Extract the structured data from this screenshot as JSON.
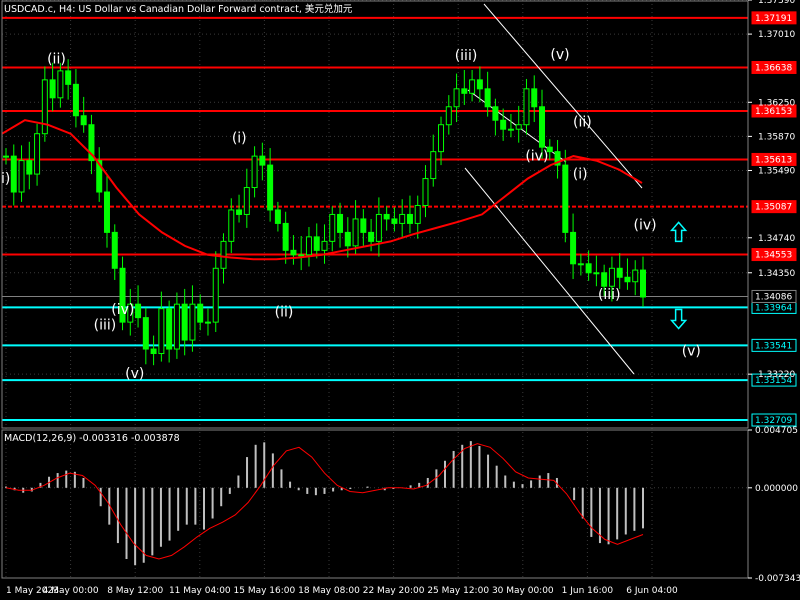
{
  "header": {
    "title": "USDCAD.c, H4:  US Dollar vs Canadian Dollar Forward contract, 美元兑加元",
    "macd_label": "MACD(12,26,9) -0.003316 -0.003878"
  },
  "colors": {
    "background": "#000000",
    "grid": "#3a3a3a",
    "candle": "#00ff00",
    "red_level": "#ff0000",
    "cyan_level": "#00ffff",
    "ma": "#ff0000",
    "channel": "#ffffff",
    "macd_hist": "#c0c0c0",
    "macd_signal": "#ff0000"
  },
  "chart_data": {
    "type": "candlestick",
    "symbol": "USDCAD.c",
    "timeframe": "H4",
    "price_axis": {
      "range": [
        1.3262,
        1.3739
      ],
      "ticks": [
        "1.37390",
        "1.37010",
        "1.36250",
        "1.35870",
        "1.35490",
        "1.34740",
        "1.34350",
        "1.33220"
      ]
    },
    "time_axis": {
      "labels": [
        "1 May 2023",
        "4 May 00:00",
        "8 May 12:00",
        "11 May 04:00",
        "15 May 16:00",
        "18 May 08:00",
        "22 May 20:00",
        "25 May 12:00",
        "30 May 00:00",
        "1 Jun 16:00",
        "6 Jun 04:00"
      ]
    },
    "close_series": [
      1.3565,
      1.3525,
      1.356,
      1.3545,
      1.359,
      1.365,
      1.363,
      1.366,
      1.3645,
      1.361,
      1.36,
      1.356,
      1.3525,
      1.348,
      1.344,
      1.338,
      1.34,
      1.3385,
      1.335,
      1.3345,
      1.3395,
      1.335,
      1.34,
      1.336,
      1.34,
      1.338,
      1.338,
      1.344,
      1.347,
      1.3505,
      1.35,
      1.353,
      1.3565,
      1.3555,
      1.3505,
      1.349,
      1.346,
      1.3455,
      1.3455,
      1.3475,
      1.346,
      1.347,
      1.35,
      1.348,
      1.3465,
      1.3495,
      1.348,
      1.347,
      1.35,
      1.3495,
      1.349,
      1.35,
      1.349,
      1.351,
      1.354,
      1.357,
      1.36,
      1.362,
      1.364,
      1.3635,
      1.365,
      1.364,
      1.362,
      1.3605,
      1.3595,
      1.3595,
      1.36,
      1.364,
      1.362,
      1.3575,
      1.357,
      1.3555,
      1.348,
      1.3445,
      1.3445,
      1.3435,
      1.3435,
      1.342,
      1.344,
      1.343,
      1.3425,
      1.3438,
      1.3408
    ],
    "close_y_range": [
      1.3262,
      1.3739
    ],
    "ma_series": [
      1.359,
      1.3605,
      1.36,
      1.359,
      1.3565,
      1.353,
      1.35,
      1.348,
      1.3465,
      1.3455,
      1.3452,
      1.345,
      1.345,
      1.3452,
      1.3455,
      1.346,
      1.3465,
      1.347,
      1.3478,
      1.3485,
      1.3492,
      1.35,
      1.352,
      1.354,
      1.3555,
      1.3565,
      1.356,
      1.355,
      1.3535
    ],
    "ma_y_range": [
      1.3262,
      1.3739
    ],
    "levels": [
      {
        "label": "1.37191",
        "value": 1.37191,
        "color": "red",
        "style": "solid"
      },
      {
        "label": "1.36638",
        "value": 1.36638,
        "color": "red",
        "style": "solid"
      },
      {
        "label": "1.36153",
        "value": 1.36153,
        "color": "red",
        "style": "solid"
      },
      {
        "label": "1.35613",
        "value": 1.35613,
        "color": "red",
        "style": "solid"
      },
      {
        "label": "1.35087",
        "value": 1.35087,
        "color": "red",
        "style": "dashed"
      },
      {
        "label": "1.34553",
        "value": 1.34553,
        "color": "red",
        "style": "solid"
      },
      {
        "label": "1.33964",
        "value": 1.33964,
        "color": "cyan",
        "style": "solid"
      },
      {
        "label": "1.33541",
        "value": 1.33541,
        "color": "cyan",
        "style": "solid"
      },
      {
        "label": "1.33154",
        "value": 1.33154,
        "color": "cyan",
        "style": "solid"
      },
      {
        "label": "1.32709",
        "value": 1.32709,
        "color": "cyan",
        "style": "solid"
      }
    ],
    "current_price": {
      "label": "1.34086",
      "value": 1.34086
    },
    "wave_labels": [
      {
        "text": "i)",
        "x_frac": 0.005,
        "value": 1.3535
      },
      {
        "text": "(ii)",
        "x_frac": 0.073,
        "value": 1.3668
      },
      {
        "text": "(iii)",
        "x_frac": 0.138,
        "value": 1.3372
      },
      {
        "text": "(iv)",
        "x_frac": 0.162,
        "value": 1.3389
      },
      {
        "text": "(v)",
        "x_frac": 0.178,
        "value": 1.3318
      },
      {
        "text": "(i)",
        "x_frac": 0.318,
        "value": 1.358
      },
      {
        "text": "(ii)",
        "x_frac": 0.378,
        "value": 1.3386
      },
      {
        "text": "(iii)",
        "x_frac": 0.622,
        "value": 1.3672
      },
      {
        "text": "(v)",
        "x_frac": 0.748,
        "value": 1.3673
      },
      {
        "text": "(ii)",
        "x_frac": 0.778,
        "value": 1.3598
      },
      {
        "text": "(iv)",
        "x_frac": 0.717,
        "value": 1.356
      },
      {
        "text": "(i)",
        "x_frac": 0.775,
        "value": 1.354
      },
      {
        "text": "(iv)",
        "x_frac": 0.862,
        "value": 1.3483
      },
      {
        "text": "(iii)",
        "x_frac": 0.814,
        "value": 1.3406
      },
      {
        "text": "(v)",
        "x_frac": 0.924,
        "value": 1.3343
      }
    ],
    "arrows": [
      {
        "direction": "up",
        "x_frac": 0.907,
        "value": 1.348
      },
      {
        "direction": "down",
        "x_frac": 0.907,
        "value": 1.3384
      }
    ],
    "macd": {
      "axis_labels": [
        "0.004705",
        "0.000000",
        "-0.007343"
      ],
      "y_range": [
        -0.007343,
        0.004705
      ],
      "histogram": [
        0.0001,
        -0.0002,
        -0.0004,
        -0.0003,
        0.0004,
        0.0009,
        0.0012,
        0.0014,
        0.0013,
        0.0008,
        0.0,
        -0.0015,
        -0.003,
        -0.0045,
        -0.0058,
        -0.0063,
        -0.0061,
        -0.0055,
        -0.0048,
        -0.0043,
        -0.0035,
        -0.003,
        -0.003,
        -0.0034,
        -0.0025,
        -0.0015,
        -0.0005,
        0.001,
        0.0025,
        0.0035,
        0.0037,
        0.0028,
        0.0015,
        0.0005,
        -0.0002,
        -0.0005,
        -0.0006,
        -0.0005,
        -0.0003,
        -0.0002,
        -0.0001,
        0.0,
        0.0001,
        0.0,
        -0.0002,
        -0.0001,
        0.0,
        0.0002,
        0.0004,
        0.0008,
        0.0015,
        0.0022,
        0.003,
        0.0035,
        0.0038,
        0.0034,
        0.0027,
        0.0018,
        0.001,
        0.0005,
        0.0003,
        0.0006,
        0.001,
        0.0012,
        0.0008,
        0.0,
        -0.001,
        -0.0025,
        -0.004,
        -0.0045,
        -0.0046,
        -0.0042,
        -0.0038,
        -0.0035,
        -0.0033
      ],
      "signal": [
        0.0,
        -0.0002,
        -0.0002,
        0.0002,
        0.0008,
        0.0012,
        0.001,
        0.0002,
        -0.0012,
        -0.003,
        -0.0045,
        -0.0055,
        -0.0058,
        -0.0055,
        -0.0048,
        -0.004,
        -0.0033,
        -0.0028,
        -0.0022,
        -0.0012,
        0.0002,
        0.0018,
        0.003,
        0.0033,
        0.0025,
        0.0012,
        0.0002,
        -0.0003,
        -0.0004,
        -0.0002,
        0.0,
        0.0,
        -0.0001,
        0.0002,
        0.001,
        0.0022,
        0.0032,
        0.0036,
        0.0033,
        0.0024,
        0.0013,
        0.0008,
        0.0007,
        0.0006,
        -0.0005,
        -0.002,
        -0.0033,
        -0.0042,
        -0.0046,
        -0.0042,
        -0.0038
      ]
    }
  }
}
